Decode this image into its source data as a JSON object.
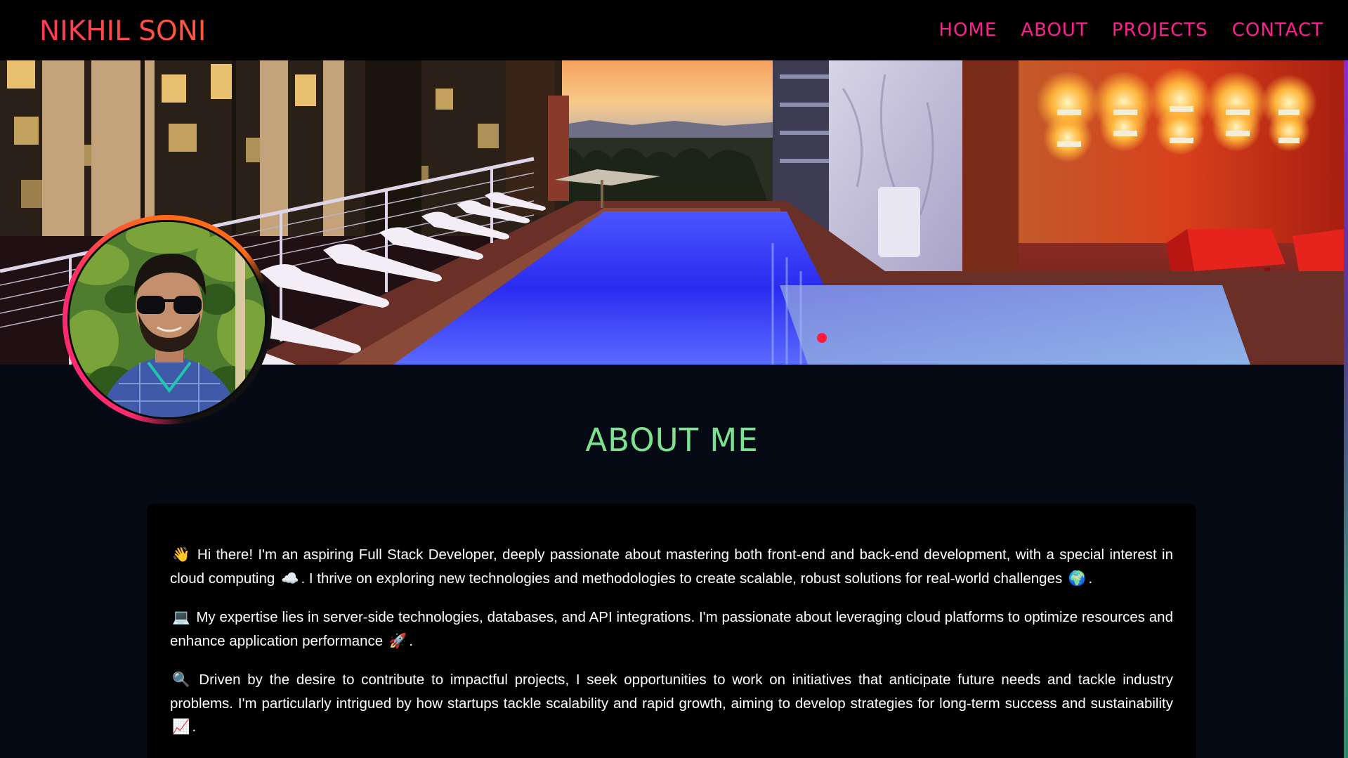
{
  "navbar": {
    "brand": "NIKHIL SONI",
    "links": [
      "HOME",
      "ABOUT",
      "PROJECTS",
      "CONTACT"
    ]
  },
  "colors": {
    "brand_gradient": [
      "#ff3b55",
      "#ff5a3a"
    ],
    "nav_link": "#ff1f8e",
    "about_title": "#7be38f",
    "page_background": "#050a14",
    "card_background": "#000000"
  },
  "hero": {
    "image": "rooftop-pool-night-scene"
  },
  "profile": {
    "avatar": "profile-photo"
  },
  "about": {
    "title": "ABOUT ME",
    "paragraphs": [
      {
        "emoji": "👋",
        "text1": " Hi there! I'm an aspiring Full Stack Developer, deeply passionate about mastering both front-end and back-end development, with a special interest in cloud computing ",
        "emoji2": "☁️",
        "text2": ". I thrive on exploring new technologies and methodologies to create scalable, robust solutions for real-world challenges ",
        "emoji3": "🌍",
        "text3": "."
      },
      {
        "emoji": "💻",
        "text1": " My expertise lies in server-side technologies, databases, and API integrations. I'm passionate about leveraging cloud platforms to optimize resources and enhance application performance ",
        "emoji2": "🚀",
        "text2": "."
      },
      {
        "emoji": "🔍",
        "text1": " Driven by the desire to contribute to impactful projects, I seek opportunities to work on initiatives that anticipate future needs and tackle industry problems. I'm particularly intrigued by how startups tackle scalability and rapid growth, aiming to develop strategies for long-term success and sustainability ",
        "emoji2": "📈",
        "text2": "."
      }
    ]
  }
}
